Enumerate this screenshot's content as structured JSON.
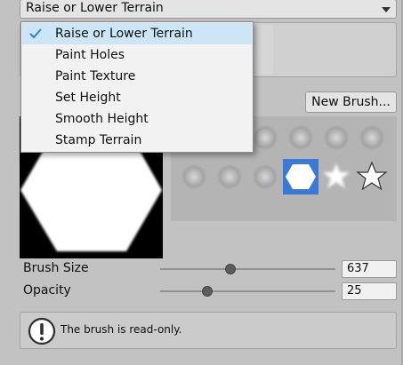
{
  "tool_selector": {
    "selected": "Raise or Lower Terrain",
    "menu_items": [
      {
        "label": "Raise or Lower Terrain",
        "checked": true
      },
      {
        "label": "Paint Holes",
        "checked": false
      },
      {
        "label": "Paint Texture",
        "checked": false
      },
      {
        "label": "Set Height",
        "checked": false
      },
      {
        "label": "Smooth Height",
        "checked": false
      },
      {
        "label": "Stamp Terrain",
        "checked": false
      }
    ]
  },
  "brushes": {
    "new_brush_label": "New Brush...",
    "selected_shape": "hexagon"
  },
  "settings": {
    "brush_size_label": "Brush Size",
    "brush_size_value": "637",
    "brush_size_fraction": 0.4,
    "opacity_label": "Opacity",
    "opacity_value": "25",
    "opacity_fraction": 0.27
  },
  "help": {
    "message": "The brush is read-only."
  },
  "colors": {
    "selection_blue": "#3a7ad6",
    "check_blue": "#2d7fd2",
    "menu_highlight": "#cde6f7"
  }
}
